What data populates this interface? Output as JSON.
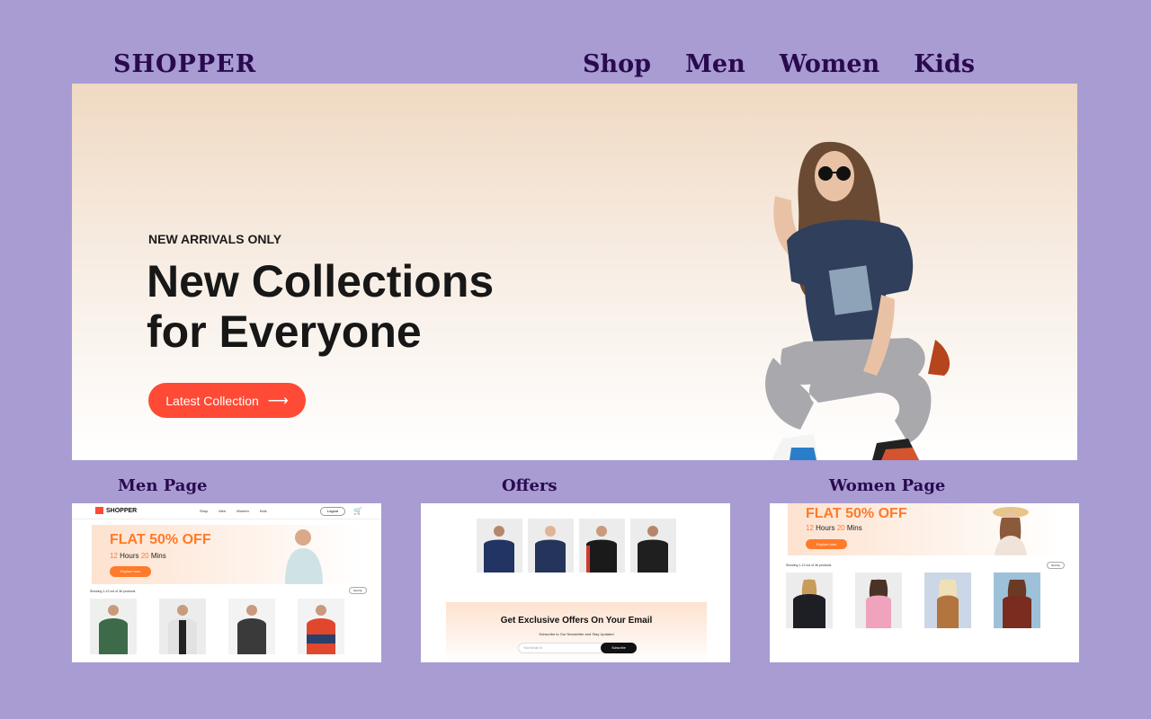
{
  "header": {
    "brand": "SHOPPER",
    "nav": [
      "Shop",
      "Men",
      "Women",
      "Kids"
    ]
  },
  "hero": {
    "kicker": "NEW ARRIVALS ONLY",
    "title_line1": "New Collections",
    "title_line2": "for Everyone",
    "button": "Latest Collection",
    "button_icon": "arrow-right-icon",
    "accent": "#ff4a35"
  },
  "previews": {
    "men_label": "Men Page",
    "offers_label": "Offers",
    "women_label": "Women Page"
  },
  "men_page": {
    "logo": "SHOPPER",
    "links": [
      "Shop",
      "Men",
      "Women",
      "Kids"
    ],
    "logout": "Logout",
    "flat": "FLAT 50% OFF",
    "hours_num": "12",
    "hours_word": "Hours",
    "mins_num": "20",
    "mins_word": "Mins",
    "explore": "Explore now",
    "sort_text": "Showing 1-12 out of 36 products",
    "sort_btn": "Sort by"
  },
  "offers_page": {
    "headline": "Get Exclusive Offers On Your Email",
    "subtext": "Subscribe to Our Newsletter and Stay Updated",
    "input_placeholder": "Your Email Id",
    "subscribe": "Subscribe"
  },
  "women_page": {
    "flat": "FLAT 50% OFF",
    "hours_num": "12",
    "hours_word": "Hours",
    "mins_num": "20",
    "mins_word": "Mins",
    "explore": "Explore now",
    "sort_text": "Showing 1-12 out of 36 products",
    "sort_btn": "Sort by"
  },
  "colors": {
    "background": "#a89cd3",
    "heading": "#2a0a4f",
    "offer_orange": "#ff7a2a"
  }
}
